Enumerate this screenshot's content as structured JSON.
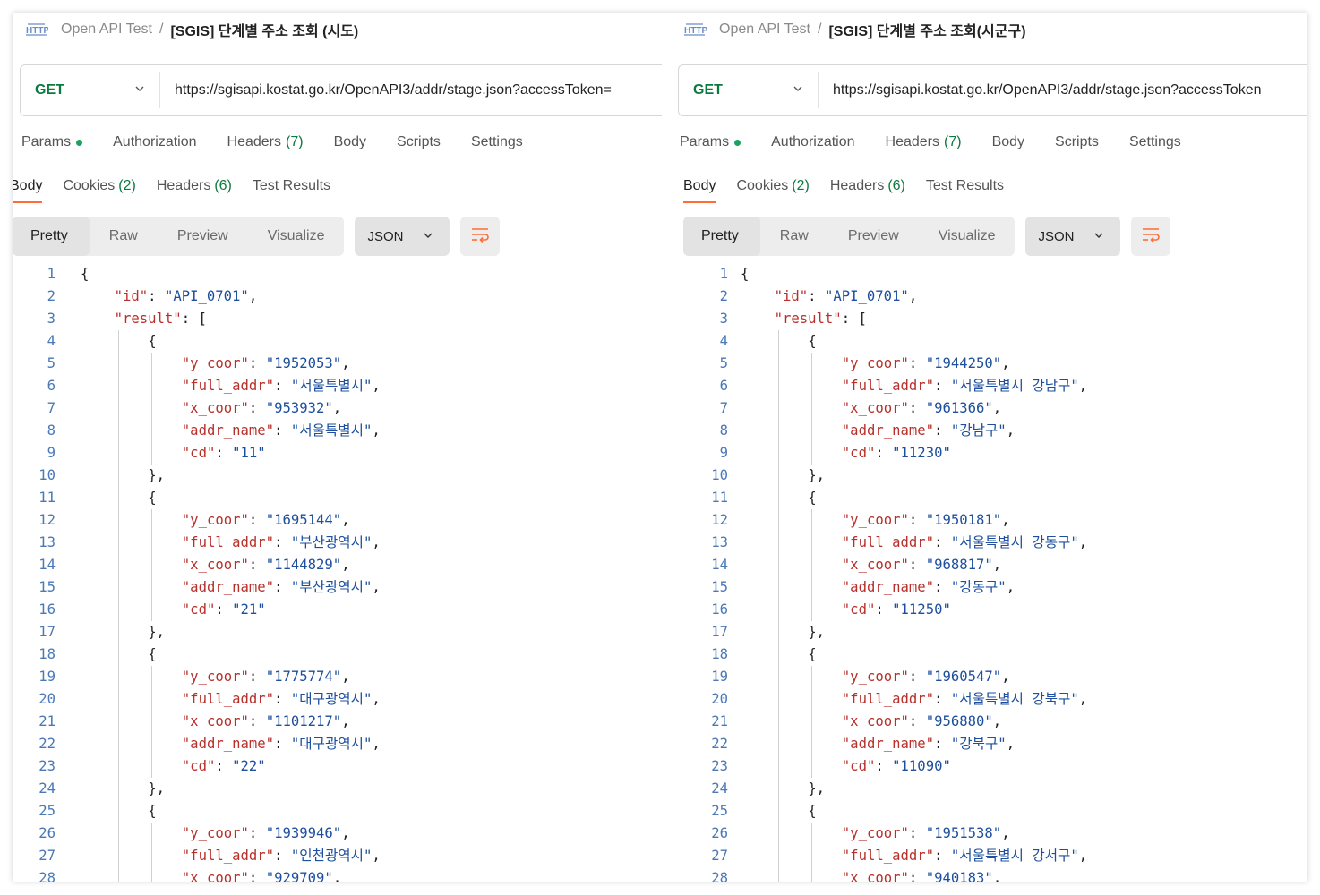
{
  "colors": {
    "method_get": "#0b7a3e",
    "json_key": "#b8302b",
    "json_string": "#1d4f9e",
    "line_number": "#4a79b6",
    "active_tab_underline": "#ff6c37",
    "params_dot": "#1aa35f"
  },
  "left": {
    "breadcrumb": {
      "collection": "Open API Test",
      "separator": "/",
      "request": "[SGIS] 단계별 주소 조회 (시도)"
    },
    "method": "GET",
    "url": "https://sgisapi.kostat.go.kr/OpenAPI3/addr/stage.json?accessToken=",
    "request_tabs": {
      "params": "Params",
      "authorization": "Authorization",
      "headers": "Headers",
      "headers_count": "(7)",
      "body": "Body",
      "scripts": "Scripts",
      "settings": "Settings"
    },
    "response_tabs": {
      "body": "Body",
      "cookies": "Cookies",
      "cookies_count": "(2)",
      "headers": "Headers",
      "headers_count": "(6)",
      "test_results": "Test Results"
    },
    "views": {
      "pretty": "Pretty",
      "raw": "Raw",
      "preview": "Preview",
      "visualize": "Visualize",
      "format": "JSON"
    },
    "lines": [
      {
        "n": "1",
        "ind": 0,
        "t": [
          [
            "p",
            "{"
          ]
        ]
      },
      {
        "n": "2",
        "ind": 1,
        "t": [
          [
            "k",
            "\"id\""
          ],
          [
            "p",
            ": "
          ],
          [
            "s",
            "\"API_0701\""
          ],
          [
            "p",
            ","
          ]
        ]
      },
      {
        "n": "3",
        "ind": 1,
        "t": [
          [
            "k",
            "\"result\""
          ],
          [
            "p",
            ": ["
          ]
        ]
      },
      {
        "n": "4",
        "ind": 2,
        "t": [
          [
            "p",
            "{"
          ]
        ]
      },
      {
        "n": "5",
        "ind": 3,
        "t": [
          [
            "k",
            "\"y_coor\""
          ],
          [
            "p",
            ": "
          ],
          [
            "s",
            "\"1952053\""
          ],
          [
            "p",
            ","
          ]
        ]
      },
      {
        "n": "6",
        "ind": 3,
        "t": [
          [
            "k",
            "\"full_addr\""
          ],
          [
            "p",
            ": "
          ],
          [
            "s",
            "\"서울특별시\""
          ],
          [
            "p",
            ","
          ]
        ]
      },
      {
        "n": "7",
        "ind": 3,
        "t": [
          [
            "k",
            "\"x_coor\""
          ],
          [
            "p",
            ": "
          ],
          [
            "s",
            "\"953932\""
          ],
          [
            "p",
            ","
          ]
        ]
      },
      {
        "n": "8",
        "ind": 3,
        "t": [
          [
            "k",
            "\"addr_name\""
          ],
          [
            "p",
            ": "
          ],
          [
            "s",
            "\"서울특별시\""
          ],
          [
            "p",
            ","
          ]
        ]
      },
      {
        "n": "9",
        "ind": 3,
        "t": [
          [
            "k",
            "\"cd\""
          ],
          [
            "p",
            ": "
          ],
          [
            "s",
            "\"11\""
          ]
        ]
      },
      {
        "n": "10",
        "ind": 2,
        "t": [
          [
            "p",
            "},"
          ]
        ]
      },
      {
        "n": "11",
        "ind": 2,
        "t": [
          [
            "p",
            "{"
          ]
        ]
      },
      {
        "n": "12",
        "ind": 3,
        "t": [
          [
            "k",
            "\"y_coor\""
          ],
          [
            "p",
            ": "
          ],
          [
            "s",
            "\"1695144\""
          ],
          [
            "p",
            ","
          ]
        ]
      },
      {
        "n": "13",
        "ind": 3,
        "t": [
          [
            "k",
            "\"full_addr\""
          ],
          [
            "p",
            ": "
          ],
          [
            "s",
            "\"부산광역시\""
          ],
          [
            "p",
            ","
          ]
        ]
      },
      {
        "n": "14",
        "ind": 3,
        "t": [
          [
            "k",
            "\"x_coor\""
          ],
          [
            "p",
            ": "
          ],
          [
            "s",
            "\"1144829\""
          ],
          [
            "p",
            ","
          ]
        ]
      },
      {
        "n": "15",
        "ind": 3,
        "t": [
          [
            "k",
            "\"addr_name\""
          ],
          [
            "p",
            ": "
          ],
          [
            "s",
            "\"부산광역시\""
          ],
          [
            "p",
            ","
          ]
        ]
      },
      {
        "n": "16",
        "ind": 3,
        "t": [
          [
            "k",
            "\"cd\""
          ],
          [
            "p",
            ": "
          ],
          [
            "s",
            "\"21\""
          ]
        ]
      },
      {
        "n": "17",
        "ind": 2,
        "t": [
          [
            "p",
            "},"
          ]
        ]
      },
      {
        "n": "18",
        "ind": 2,
        "t": [
          [
            "p",
            "{"
          ]
        ]
      },
      {
        "n": "19",
        "ind": 3,
        "t": [
          [
            "k",
            "\"y_coor\""
          ],
          [
            "p",
            ": "
          ],
          [
            "s",
            "\"1775774\""
          ],
          [
            "p",
            ","
          ]
        ]
      },
      {
        "n": "20",
        "ind": 3,
        "t": [
          [
            "k",
            "\"full_addr\""
          ],
          [
            "p",
            ": "
          ],
          [
            "s",
            "\"대구광역시\""
          ],
          [
            "p",
            ","
          ]
        ]
      },
      {
        "n": "21",
        "ind": 3,
        "t": [
          [
            "k",
            "\"x_coor\""
          ],
          [
            "p",
            ": "
          ],
          [
            "s",
            "\"1101217\""
          ],
          [
            "p",
            ","
          ]
        ]
      },
      {
        "n": "22",
        "ind": 3,
        "t": [
          [
            "k",
            "\"addr_name\""
          ],
          [
            "p",
            ": "
          ],
          [
            "s",
            "\"대구광역시\""
          ],
          [
            "p",
            ","
          ]
        ]
      },
      {
        "n": "23",
        "ind": 3,
        "t": [
          [
            "k",
            "\"cd\""
          ],
          [
            "p",
            ": "
          ],
          [
            "s",
            "\"22\""
          ]
        ]
      },
      {
        "n": "24",
        "ind": 2,
        "t": [
          [
            "p",
            "},"
          ]
        ]
      },
      {
        "n": "25",
        "ind": 2,
        "t": [
          [
            "p",
            "{"
          ]
        ]
      },
      {
        "n": "26",
        "ind": 3,
        "t": [
          [
            "k",
            "\"y_coor\""
          ],
          [
            "p",
            ": "
          ],
          [
            "s",
            "\"1939946\""
          ],
          [
            "p",
            ","
          ]
        ]
      },
      {
        "n": "27",
        "ind": 3,
        "t": [
          [
            "k",
            "\"full_addr\""
          ],
          [
            "p",
            ": "
          ],
          [
            "s",
            "\"인천광역시\""
          ],
          [
            "p",
            ","
          ]
        ]
      },
      {
        "n": "28",
        "ind": 3,
        "t": [
          [
            "k",
            "\"x_coor\""
          ],
          [
            "p",
            ": "
          ],
          [
            "s",
            "\"929709\""
          ],
          [
            "p",
            ","
          ]
        ]
      }
    ]
  },
  "right": {
    "breadcrumb": {
      "collection": "Open API Test",
      "separator": "/",
      "request": "[SGIS] 단계별 주소 조회(시군구)"
    },
    "method": "GET",
    "url": "https://sgisapi.kostat.go.kr/OpenAPI3/addr/stage.json?accessToken",
    "request_tabs": {
      "params": "Params",
      "authorization": "Authorization",
      "headers": "Headers",
      "headers_count": "(7)",
      "body": "Body",
      "scripts": "Scripts",
      "settings": "Settings"
    },
    "response_tabs": {
      "body": "Body",
      "cookies": "Cookies",
      "cookies_count": "(2)",
      "headers": "Headers",
      "headers_count": "(6)",
      "test_results": "Test Results"
    },
    "views": {
      "pretty": "Pretty",
      "raw": "Raw",
      "preview": "Preview",
      "visualize": "Visualize",
      "format": "JSON"
    },
    "lines": [
      {
        "n": "1",
        "ind": 0,
        "t": [
          [
            "p",
            "{"
          ]
        ]
      },
      {
        "n": "2",
        "ind": 1,
        "t": [
          [
            "k",
            "\"id\""
          ],
          [
            "p",
            ": "
          ],
          [
            "s",
            "\"API_0701\""
          ],
          [
            "p",
            ","
          ]
        ]
      },
      {
        "n": "3",
        "ind": 1,
        "t": [
          [
            "k",
            "\"result\""
          ],
          [
            "p",
            ": ["
          ]
        ]
      },
      {
        "n": "4",
        "ind": 2,
        "t": [
          [
            "p",
            "{"
          ]
        ]
      },
      {
        "n": "5",
        "ind": 3,
        "t": [
          [
            "k",
            "\"y_coor\""
          ],
          [
            "p",
            ": "
          ],
          [
            "s",
            "\"1944250\""
          ],
          [
            "p",
            ","
          ]
        ]
      },
      {
        "n": "6",
        "ind": 3,
        "t": [
          [
            "k",
            "\"full_addr\""
          ],
          [
            "p",
            ": "
          ],
          [
            "s",
            "\"서울특별시 강남구\""
          ],
          [
            "p",
            ","
          ]
        ]
      },
      {
        "n": "7",
        "ind": 3,
        "t": [
          [
            "k",
            "\"x_coor\""
          ],
          [
            "p",
            ": "
          ],
          [
            "s",
            "\"961366\""
          ],
          [
            "p",
            ","
          ]
        ]
      },
      {
        "n": "8",
        "ind": 3,
        "t": [
          [
            "k",
            "\"addr_name\""
          ],
          [
            "p",
            ": "
          ],
          [
            "s",
            "\"강남구\""
          ],
          [
            "p",
            ","
          ]
        ]
      },
      {
        "n": "9",
        "ind": 3,
        "t": [
          [
            "k",
            "\"cd\""
          ],
          [
            "p",
            ": "
          ],
          [
            "s",
            "\"11230\""
          ]
        ]
      },
      {
        "n": "10",
        "ind": 2,
        "t": [
          [
            "p",
            "},"
          ]
        ]
      },
      {
        "n": "11",
        "ind": 2,
        "t": [
          [
            "p",
            "{"
          ]
        ]
      },
      {
        "n": "12",
        "ind": 3,
        "t": [
          [
            "k",
            "\"y_coor\""
          ],
          [
            "p",
            ": "
          ],
          [
            "s",
            "\"1950181\""
          ],
          [
            "p",
            ","
          ]
        ]
      },
      {
        "n": "13",
        "ind": 3,
        "t": [
          [
            "k",
            "\"full_addr\""
          ],
          [
            "p",
            ": "
          ],
          [
            "s",
            "\"서울특별시 강동구\""
          ],
          [
            "p",
            ","
          ]
        ]
      },
      {
        "n": "14",
        "ind": 3,
        "t": [
          [
            "k",
            "\"x_coor\""
          ],
          [
            "p",
            ": "
          ],
          [
            "s",
            "\"968817\""
          ],
          [
            "p",
            ","
          ]
        ]
      },
      {
        "n": "15",
        "ind": 3,
        "t": [
          [
            "k",
            "\"addr_name\""
          ],
          [
            "p",
            ": "
          ],
          [
            "s",
            "\"강동구\""
          ],
          [
            "p",
            ","
          ]
        ]
      },
      {
        "n": "16",
        "ind": 3,
        "t": [
          [
            "k",
            "\"cd\""
          ],
          [
            "p",
            ": "
          ],
          [
            "s",
            "\"11250\""
          ]
        ]
      },
      {
        "n": "17",
        "ind": 2,
        "t": [
          [
            "p",
            "},"
          ]
        ]
      },
      {
        "n": "18",
        "ind": 2,
        "t": [
          [
            "p",
            "{"
          ]
        ]
      },
      {
        "n": "19",
        "ind": 3,
        "t": [
          [
            "k",
            "\"y_coor\""
          ],
          [
            "p",
            ": "
          ],
          [
            "s",
            "\"1960547\""
          ],
          [
            "p",
            ","
          ]
        ]
      },
      {
        "n": "20",
        "ind": 3,
        "t": [
          [
            "k",
            "\"full_addr\""
          ],
          [
            "p",
            ": "
          ],
          [
            "s",
            "\"서울특별시 강북구\""
          ],
          [
            "p",
            ","
          ]
        ]
      },
      {
        "n": "21",
        "ind": 3,
        "t": [
          [
            "k",
            "\"x_coor\""
          ],
          [
            "p",
            ": "
          ],
          [
            "s",
            "\"956880\""
          ],
          [
            "p",
            ","
          ]
        ]
      },
      {
        "n": "22",
        "ind": 3,
        "t": [
          [
            "k",
            "\"addr_name\""
          ],
          [
            "p",
            ": "
          ],
          [
            "s",
            "\"강북구\""
          ],
          [
            "p",
            ","
          ]
        ]
      },
      {
        "n": "23",
        "ind": 3,
        "t": [
          [
            "k",
            "\"cd\""
          ],
          [
            "p",
            ": "
          ],
          [
            "s",
            "\"11090\""
          ]
        ]
      },
      {
        "n": "24",
        "ind": 2,
        "t": [
          [
            "p",
            "},"
          ]
        ]
      },
      {
        "n": "25",
        "ind": 2,
        "t": [
          [
            "p",
            "{"
          ]
        ]
      },
      {
        "n": "26",
        "ind": 3,
        "t": [
          [
            "k",
            "\"y_coor\""
          ],
          [
            "p",
            ": "
          ],
          [
            "s",
            "\"1951538\""
          ],
          [
            "p",
            ","
          ]
        ]
      },
      {
        "n": "27",
        "ind": 3,
        "t": [
          [
            "k",
            "\"full_addr\""
          ],
          [
            "p",
            ": "
          ],
          [
            "s",
            "\"서울특별시 강서구\""
          ],
          [
            "p",
            ","
          ]
        ]
      },
      {
        "n": "28",
        "ind": 3,
        "t": [
          [
            "k",
            "\"x_coor\""
          ],
          [
            "p",
            ": "
          ],
          [
            "s",
            "\"940183\""
          ],
          [
            "p",
            ","
          ]
        ]
      }
    ]
  }
}
